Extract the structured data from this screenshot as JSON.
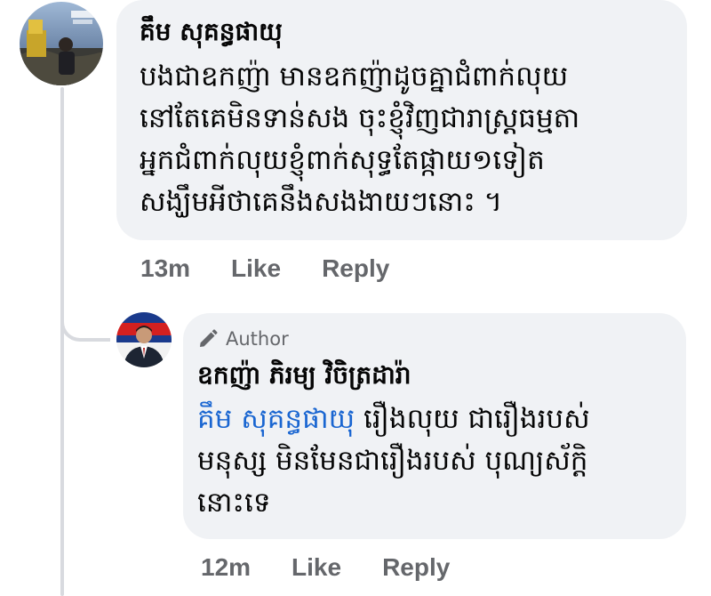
{
  "comment": {
    "author": "គឹម សុគន្ធផាយុ",
    "lines": [
      "បងជាឧកញ៉ា មានឧកញ៉ាដូចគ្នាជំពាក់លុយ",
      "នៅតែគេមិនទាន់សង ចុះខ្ញុំវិញជារាស្ត្រធម្មតា",
      "អ្នកជំពាក់លុយខ្ញុំពាក់សុទ្ធតែផ្កាយ១ទៀត",
      "សង្ឃឹមអីថាគេនឹងសងងាយៗនោះ ។"
    ],
    "time": "13m",
    "like_label": "Like",
    "reply_label": "Reply"
  },
  "reply": {
    "badge": "Author",
    "badge_icon": "pencil-icon",
    "author": "ឧកញ៉ា ភិរម្យ វិចិត្រដារ៉ា",
    "mention": "គឹម សុគន្ធផាយុ",
    "line1_rest": " រឿងលុយ ជារឿងរបស់",
    "line2": "មនុស្ស មិនមែនជារឿងរបស់ បុណ្យស័ក្តិ",
    "line3": "នោះទេ",
    "time": "12m",
    "like_label": "Like",
    "reply_label": "Reply"
  },
  "colors": {
    "bubble": "#f0f2f5",
    "text": "#050505",
    "secondary": "#65676b",
    "mention": "#1a66d1",
    "thread_line": "#d8dadf"
  }
}
